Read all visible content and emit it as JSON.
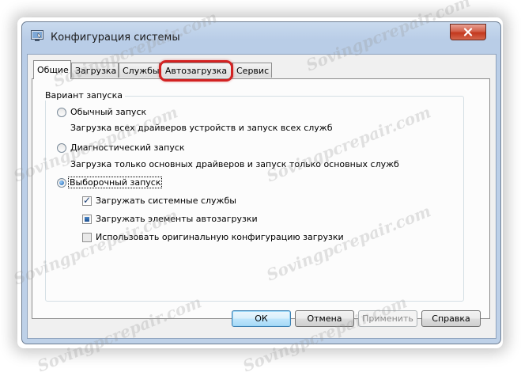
{
  "window": {
    "title": "Конфигурация системы",
    "icon": "msconfig-icon"
  },
  "tabs": [
    {
      "label": "Общие",
      "active": true
    },
    {
      "label": "Загрузка",
      "active": false
    },
    {
      "label": "Службы",
      "active": false
    },
    {
      "label": "Автозагрузка",
      "active": false,
      "highlighted": true
    },
    {
      "label": "Сервис",
      "active": false
    }
  ],
  "startup": {
    "group_title": "Вариант запуска",
    "options": [
      {
        "label": "Обычный запуск",
        "description": "Загрузка всех драйверов устройств и запуск всех служб",
        "selected": false
      },
      {
        "label": "Диагностический запуск",
        "description": "Загрузка только основных драйверов и запуск только основных служб",
        "selected": false
      },
      {
        "label": "Выборочный запуск",
        "selected": true
      }
    ],
    "checks": [
      {
        "label": "Загружать системные службы",
        "state": "checked"
      },
      {
        "label": "Загружать элементы автозагрузки",
        "state": "indeterminate"
      },
      {
        "label": "Использовать оригинальную конфигурацию загрузки",
        "state": "unchecked"
      }
    ]
  },
  "buttons": {
    "ok": "ОК",
    "cancel": "Отмена",
    "apply": "Применить",
    "help": "Справка"
  },
  "watermark": "Sovingpcrepair.com",
  "colors": {
    "highlight_ring": "#d32222",
    "title_gradient": "#bed1e8"
  }
}
